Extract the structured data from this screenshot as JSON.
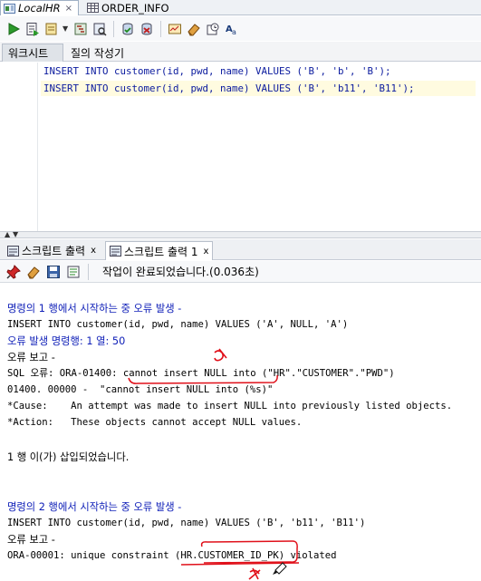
{
  "doc_tabs": [
    {
      "label": "LocalHR"
    },
    {
      "label": "ORDER_INFO"
    }
  ],
  "worksheet_tabs": [
    {
      "label": "워크시트"
    },
    {
      "label": "질의 작성기"
    }
  ],
  "editor": {
    "lines": [
      "INSERT INTO customer(id, pwd, name) VALUES ('B', 'b', 'B');",
      "INSERT INTO customer(id, pwd, name) VALUES ('B', 'b11', 'B11');"
    ]
  },
  "output_tabs": [
    {
      "label": "스크립트 출력",
      "close": "x"
    },
    {
      "label": "스크립트 출력 1",
      "close": "x"
    }
  ],
  "output_toolbar": {
    "status": "작업이 완료되었습니다.(0.036초)"
  },
  "output": {
    "lines": [
      "명령의 1 행에서 시작하는 중 오류 발생 -",
      "INSERT INTO customer(id, pwd, name) VALUES ('A', NULL, 'A')",
      "오류 발생 명령행: 1 열: 50",
      "오류 보고 -",
      "SQL 오류: ORA-01400: cannot insert NULL into (\"HR\".\"CUSTOMER\".\"PWD\")",
      "01400. 00000 -  \"cannot insert NULL into (%s)\"",
      "*Cause:    An attempt was made to insert NULL into previously listed objects.",
      "*Action:   These objects cannot accept NULL values.",
      "1 행 이(가) 삽입되었습니다.",
      "명령의 2 행에서 시작하는 중 오류 발생 -",
      "INSERT INTO customer(id, pwd, name) VALUES ('B', 'b11', 'B11')",
      "오류 보고 -",
      "ORA-00001: unique constraint (HR.CUSTOMER_ID_PK) violated"
    ]
  },
  "colors": {
    "sql_keyword_blue": "#0a1a9e",
    "error_blue": "#1020b8",
    "annotation_red": "#e0101a"
  }
}
